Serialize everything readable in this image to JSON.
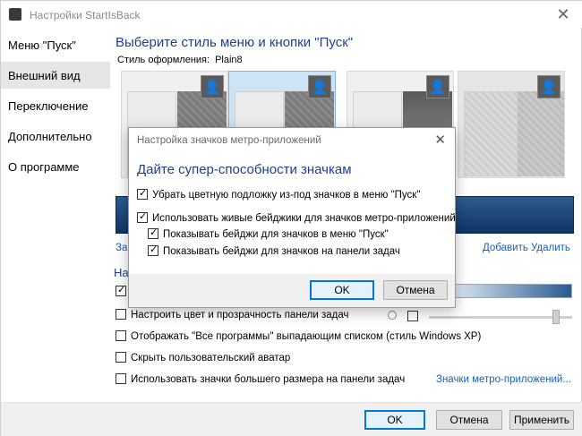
{
  "window": {
    "title": "Настройки StartIsBack",
    "close_glyph": "✕"
  },
  "sidebar": {
    "items": [
      {
        "label": "Меню \"Пуск\""
      },
      {
        "label": "Внешний вид"
      },
      {
        "label": "Переключение"
      },
      {
        "label": "Дополнительно"
      },
      {
        "label": "О программе"
      }
    ]
  },
  "main": {
    "heading": "Выберите стиль меню и кнопки \"Пуск\"",
    "style_label": "Стиль оформления:",
    "style_value": "Plain8",
    "add_link": "Добавить",
    "delete_link": "Удалить",
    "left_link_cut": "Заг",
    "section_cut": "На",
    "options": [
      {
        "label": "Настроить цвет и прозрачность панели задач",
        "checked": false
      },
      {
        "label": "Отображать \"Все программы\" выпадающим списком (стиль Windows XP)",
        "checked": false
      },
      {
        "label": "Скрыть пользовательский аватар",
        "checked": false
      },
      {
        "label": "Использовать значки большего размера на панели задач",
        "checked": false
      }
    ],
    "metro_link": "Значки метро-приложений..."
  },
  "footer": {
    "ok": "OK",
    "cancel": "Отмена",
    "apply": "Применить"
  },
  "dialog": {
    "title": "Настройка значков метро-приложений",
    "close_glyph": "✕",
    "heading": "Дайте супер-способности значкам",
    "options": [
      {
        "label": "Убрать цветную подложку из-под значков в меню \"Пуск\"",
        "checked": true
      },
      {
        "label": "Использовать живые бейджики для значков метро-приложений",
        "checked": true
      },
      {
        "label": "Показывать бейджи для значков в меню \"Пуск\"",
        "checked": true
      },
      {
        "label": "Показывать бейджи для значков на панели задач",
        "checked": true
      }
    ],
    "ok": "OK",
    "cancel": "Отмена"
  },
  "colors": {
    "accent": "#1f3f8a",
    "link": "#1a5fb4",
    "selection": "#cde4f7",
    "default_button_border": "#0078d7"
  }
}
